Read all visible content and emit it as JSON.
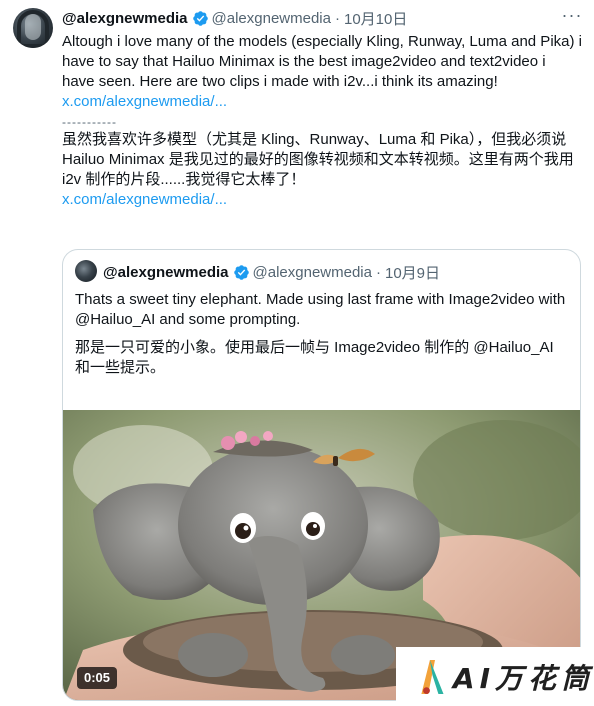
{
  "tweet": {
    "display_name": "@alexgnewmedia",
    "handle": "@alexgnewmedia",
    "separator": "·",
    "date": "10月10日",
    "more_label": "···",
    "text_en": "Altough i love many of the models (especially Kling, Runway, Luma and Pika) i have to say that Hailuo Minimax is the best image2video and text2video i have seen. Here are two clips i made with i2v...i think its amazing!",
    "link_en": "x.com/alexgnewmedia/...",
    "divider": "-----------",
    "text_cn": "虽然我喜欢许多模型（尤其是 Kling、Runway、Luma 和 Pika），但我必须说 Hailuo Minimax 是我见过的最好的图像转视频和文本转视频。这里有两个我用 i2v 制作的片段......我觉得它太棒了！",
    "link_cn": "x.com/alexgnewmedia/..."
  },
  "quote": {
    "display_name": "@alexgnewmedia",
    "handle": "@alexgnewmedia",
    "separator": "·",
    "date": "10月9日",
    "text_en": "Thats a sweet tiny elephant. Made using last frame with Image2video with @Hailuo_AI and some prompting.",
    "text_cn": "那是一只可爱的小象。使用最后一帧与 Image2video 制作的 @Hailuo_AI 和一些提示。",
    "video_duration": "0:05"
  },
  "watermark": {
    "text": "AI万花筒"
  },
  "colors": {
    "link": "#1d9bf0",
    "verified": "#1d9bf0",
    "secondary_text": "#536471",
    "border": "#cfd9de"
  },
  "icons": [
    "verified-badge-icon",
    "more-icon"
  ]
}
